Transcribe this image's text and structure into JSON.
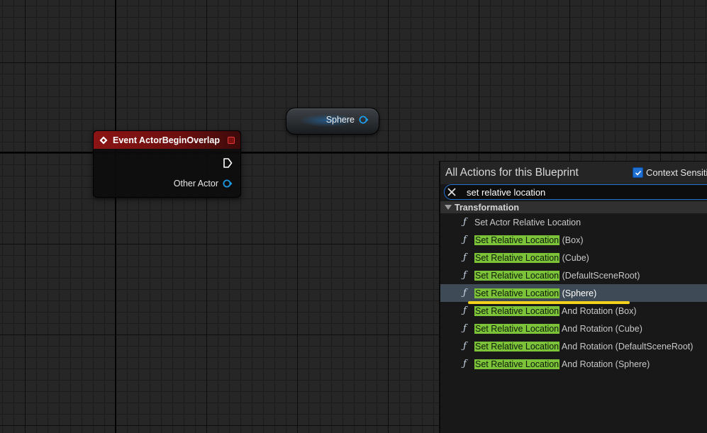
{
  "event_node": {
    "title": "Event ActorBeginOverlap",
    "output_pin_label": "Other Actor",
    "header_color": "#8c1414"
  },
  "sphere_node": {
    "label": "Sphere",
    "pin_color": "#1e9be6"
  },
  "menu": {
    "title": "All Actions for this Blueprint",
    "context_label": "Context Sensitive",
    "context_checked": true,
    "search_value": "set relative location",
    "category": "Transformation",
    "items": [
      {
        "highlight": "",
        "text": "Set Actor Relative Location",
        "selected": false
      },
      {
        "highlight": "Set Relative Location",
        "text": " (Box)",
        "selected": false
      },
      {
        "highlight": "Set Relative Location",
        "text": " (Cube)",
        "selected": false
      },
      {
        "highlight": "Set Relative Location",
        "text": " (DefaultSceneRoot)",
        "selected": false
      },
      {
        "highlight": "Set Relative Location",
        "text": " (Sphere)",
        "selected": true
      },
      {
        "highlight": "Set Relative Location",
        "text": " And Rotation (Box)",
        "selected": false
      },
      {
        "highlight": "Set Relative Location",
        "text": " And Rotation (Cube)",
        "selected": false
      },
      {
        "highlight": "Set Relative Location",
        "text": " And Rotation (DefaultSceneRoot)",
        "selected": false
      },
      {
        "highlight": "Set Relative Location",
        "text": " And Rotation (Sphere)",
        "selected": false
      }
    ],
    "function_icon": "function-f-icon",
    "highlight_color": "#7cc33a",
    "selected_color": "#3f4a57",
    "annotation_color": "#f3d21b"
  }
}
